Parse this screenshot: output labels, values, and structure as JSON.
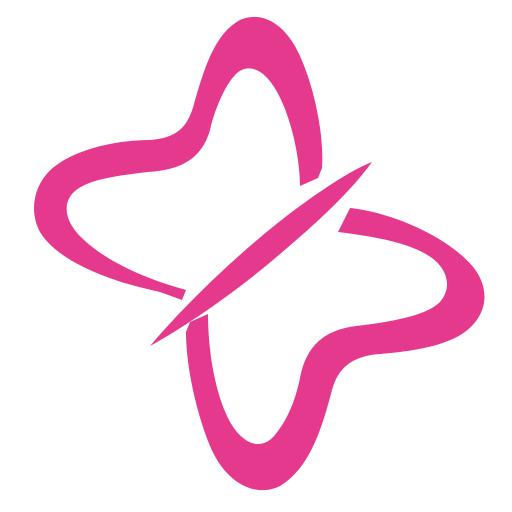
{
  "logo": {
    "name": "pink-butterfly-logo",
    "color": "#E5398E",
    "background": "#FFFFFF"
  }
}
